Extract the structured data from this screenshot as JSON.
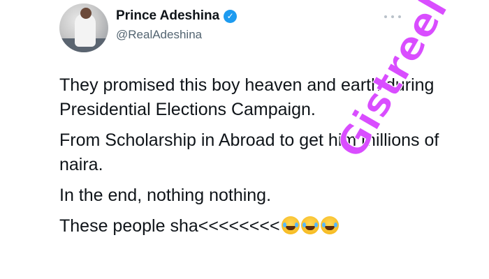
{
  "tweet": {
    "author": {
      "display_name": "Prince Adeshina",
      "handle": "@RealAdeshina",
      "verified": true
    },
    "paragraphs": [
      "They promised this boy heaven and earth during Presidential Elections Campaign.",
      "From Scholarship in Abroad to get him millions of naira.",
      "In the end, nothing nothing."
    ],
    "last_line_text": "These people sha<<<<<<<<",
    "last_line_emojis": [
      "laughing-tears-emoji",
      "laughing-tears-emoji",
      "laughing-tears-emoji"
    ],
    "more_menu_icon": "more-horizontal-icon"
  },
  "watermark": {
    "text": "Gistreel",
    "color": "#d94dff"
  },
  "colors": {
    "verified_blue": "#1d9bf0",
    "text_primary": "#0f1419",
    "text_secondary": "#536471"
  }
}
